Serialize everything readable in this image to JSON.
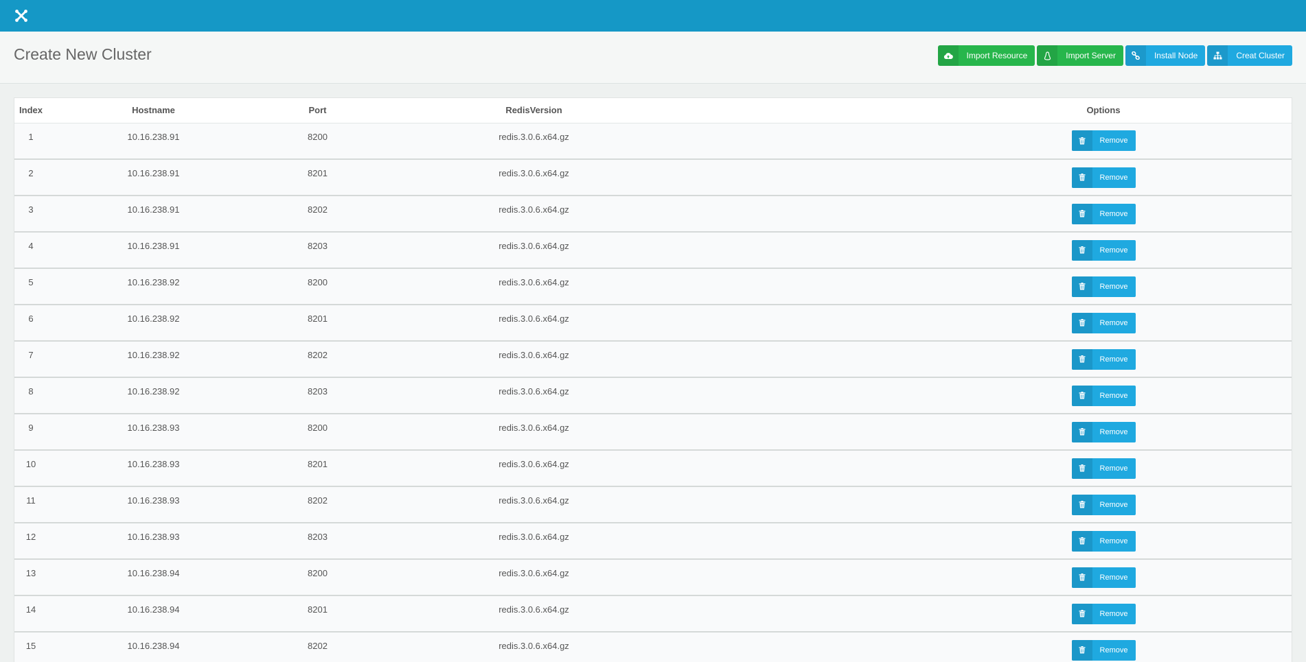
{
  "topbar": {
    "logo_icon": "joomla-logo-icon",
    "color": "#1598c6"
  },
  "header": {
    "title": "Create New Cluster"
  },
  "actions": [
    {
      "name": "import-resource-button",
      "icon": "cloud-upload-icon",
      "label": "Import Resource",
      "color": "#27b64c"
    },
    {
      "name": "import-server-button",
      "icon": "linux-icon",
      "label": "Import Server",
      "color": "#27b64c"
    },
    {
      "name": "install-node-button",
      "icon": "link-icon",
      "label": "Install Node",
      "color": "#1fa9e0"
    },
    {
      "name": "create-cluster-button",
      "icon": "sitemap-icon",
      "label": "Creat Cluster",
      "color": "#1fa9e0"
    }
  ],
  "table": {
    "columns": [
      "Index",
      "Hostname",
      "Port",
      "RedisVersion",
      "Options"
    ],
    "remove_label": "Remove",
    "rows": [
      {
        "index": "1",
        "hostname": "10.16.238.91",
        "port": "8200",
        "version": "redis.3.0.6.x64.gz"
      },
      {
        "index": "2",
        "hostname": "10.16.238.91",
        "port": "8201",
        "version": "redis.3.0.6.x64.gz"
      },
      {
        "index": "3",
        "hostname": "10.16.238.91",
        "port": "8202",
        "version": "redis.3.0.6.x64.gz"
      },
      {
        "index": "4",
        "hostname": "10.16.238.91",
        "port": "8203",
        "version": "redis.3.0.6.x64.gz"
      },
      {
        "index": "5",
        "hostname": "10.16.238.92",
        "port": "8200",
        "version": "redis.3.0.6.x64.gz"
      },
      {
        "index": "6",
        "hostname": "10.16.238.92",
        "port": "8201",
        "version": "redis.3.0.6.x64.gz"
      },
      {
        "index": "7",
        "hostname": "10.16.238.92",
        "port": "8202",
        "version": "redis.3.0.6.x64.gz"
      },
      {
        "index": "8",
        "hostname": "10.16.238.92",
        "port": "8203",
        "version": "redis.3.0.6.x64.gz"
      },
      {
        "index": "9",
        "hostname": "10.16.238.93",
        "port": "8200",
        "version": "redis.3.0.6.x64.gz"
      },
      {
        "index": "10",
        "hostname": "10.16.238.93",
        "port": "8201",
        "version": "redis.3.0.6.x64.gz"
      },
      {
        "index": "11",
        "hostname": "10.16.238.93",
        "port": "8202",
        "version": "redis.3.0.6.x64.gz"
      },
      {
        "index": "12",
        "hostname": "10.16.238.93",
        "port": "8203",
        "version": "redis.3.0.6.x64.gz"
      },
      {
        "index": "13",
        "hostname": "10.16.238.94",
        "port": "8200",
        "version": "redis.3.0.6.x64.gz"
      },
      {
        "index": "14",
        "hostname": "10.16.238.94",
        "port": "8201",
        "version": "redis.3.0.6.x64.gz"
      },
      {
        "index": "15",
        "hostname": "10.16.238.94",
        "port": "8202",
        "version": "redis.3.0.6.x64.gz"
      }
    ]
  }
}
